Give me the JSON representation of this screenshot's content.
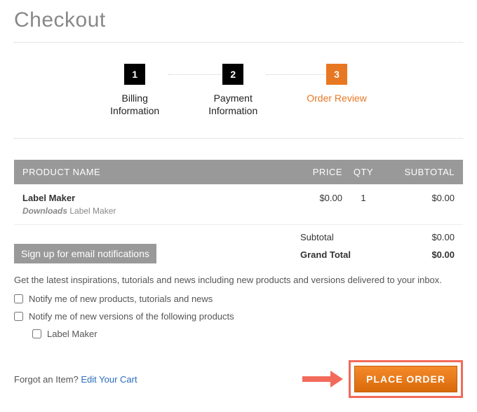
{
  "page": {
    "title": "Checkout"
  },
  "steps": [
    {
      "num": "1",
      "label_line1": "Billing",
      "label_line2": "Information"
    },
    {
      "num": "2",
      "label_line1": "Payment",
      "label_line2": "Information"
    },
    {
      "num": "3",
      "label_line1": "Order Review",
      "label_line2": ""
    }
  ],
  "table": {
    "headers": {
      "name": "PRODUCT NAME",
      "price": "PRICE",
      "qty": "QTY",
      "subtotal": "SUBTOTAL"
    },
    "rows": [
      {
        "title": "Label Maker",
        "sub_prefix": "Downloads",
        "sub_name": "Label Maker",
        "price": "$0.00",
        "qty": "1",
        "subtotal": "$0.00"
      }
    ]
  },
  "totals": {
    "subtotal_label": "Subtotal",
    "subtotal_value": "$0.00",
    "grand_label": "Grand Total",
    "grand_value": "$0.00"
  },
  "signup": {
    "banner": "Sign up for email notifications",
    "desc": "Get the latest inspirations, tutorials and news including new products and versions delivered to your inbox.",
    "opt1": "Notify me of new products, tutorials and news",
    "opt2": "Notify me of new versions of the following products",
    "opt2_items": [
      "Label Maker"
    ]
  },
  "footer": {
    "forgot_text": "Forgot an Item? ",
    "edit_cart": "Edit Your Cart",
    "place_order": "PLACE ORDER"
  },
  "colors": {
    "accent": "#e87722",
    "arrow": "#f26a5a"
  }
}
